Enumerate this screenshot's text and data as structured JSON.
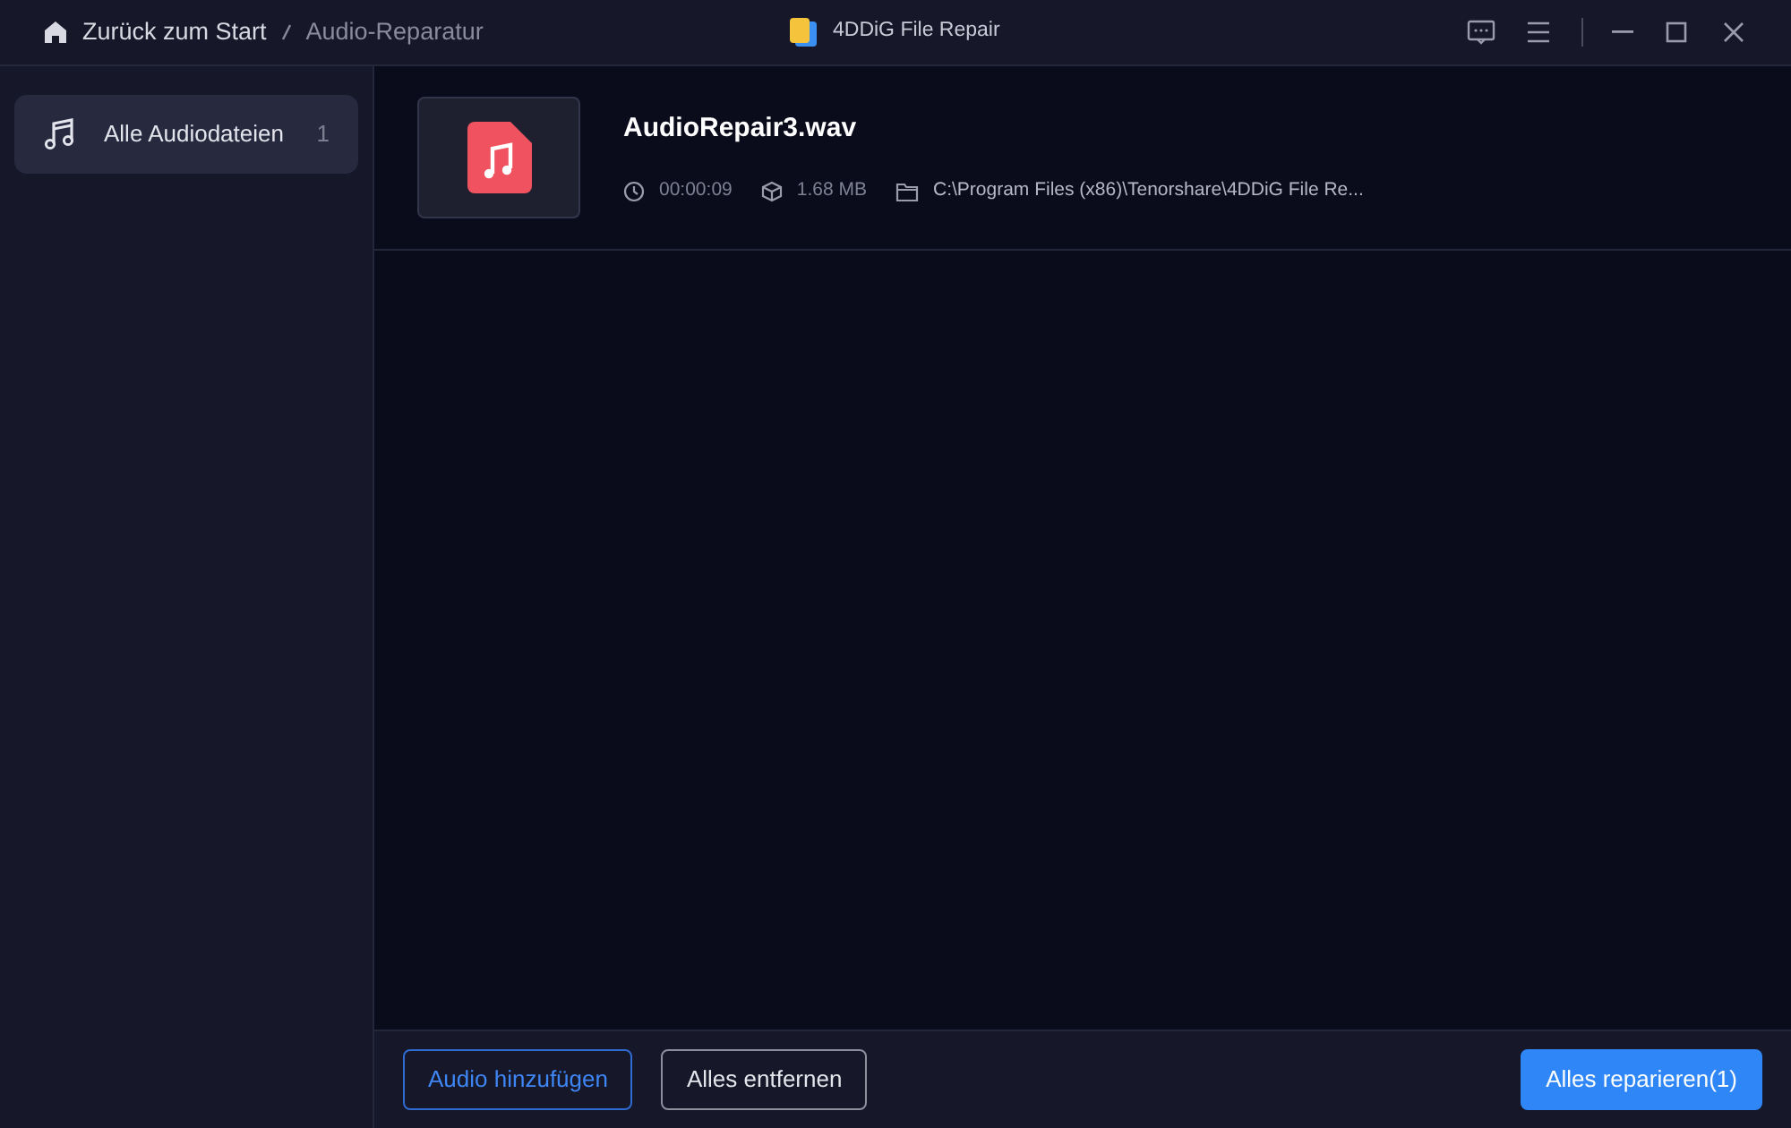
{
  "title_bar": {
    "breadcrumb": [
      {
        "label": "Zurück zum Start",
        "kind": "home"
      },
      {
        "label": "Audio-Reparatur",
        "kind": "current"
      }
    ],
    "app_title": "4DDiG File Repair"
  },
  "sidebar": {
    "items": [
      {
        "label": "Alle Audiodateien",
        "count": "1",
        "selected": true
      }
    ]
  },
  "files": [
    {
      "name": "AudioRepair3.wav",
      "duration": "00:00:09",
      "size": "1.68 MB",
      "path": "C:\\Program Files (x86)\\Tenorshare\\4DDiG File Re..."
    }
  ],
  "footer": {
    "buttons": [
      {
        "label": "Audio hinzufügen",
        "kind": "outline-primary"
      },
      {
        "label": "Alles entfernen",
        "kind": "outline"
      },
      {
        "label": "Alles reparieren(1)",
        "kind": "primary"
      }
    ]
  }
}
